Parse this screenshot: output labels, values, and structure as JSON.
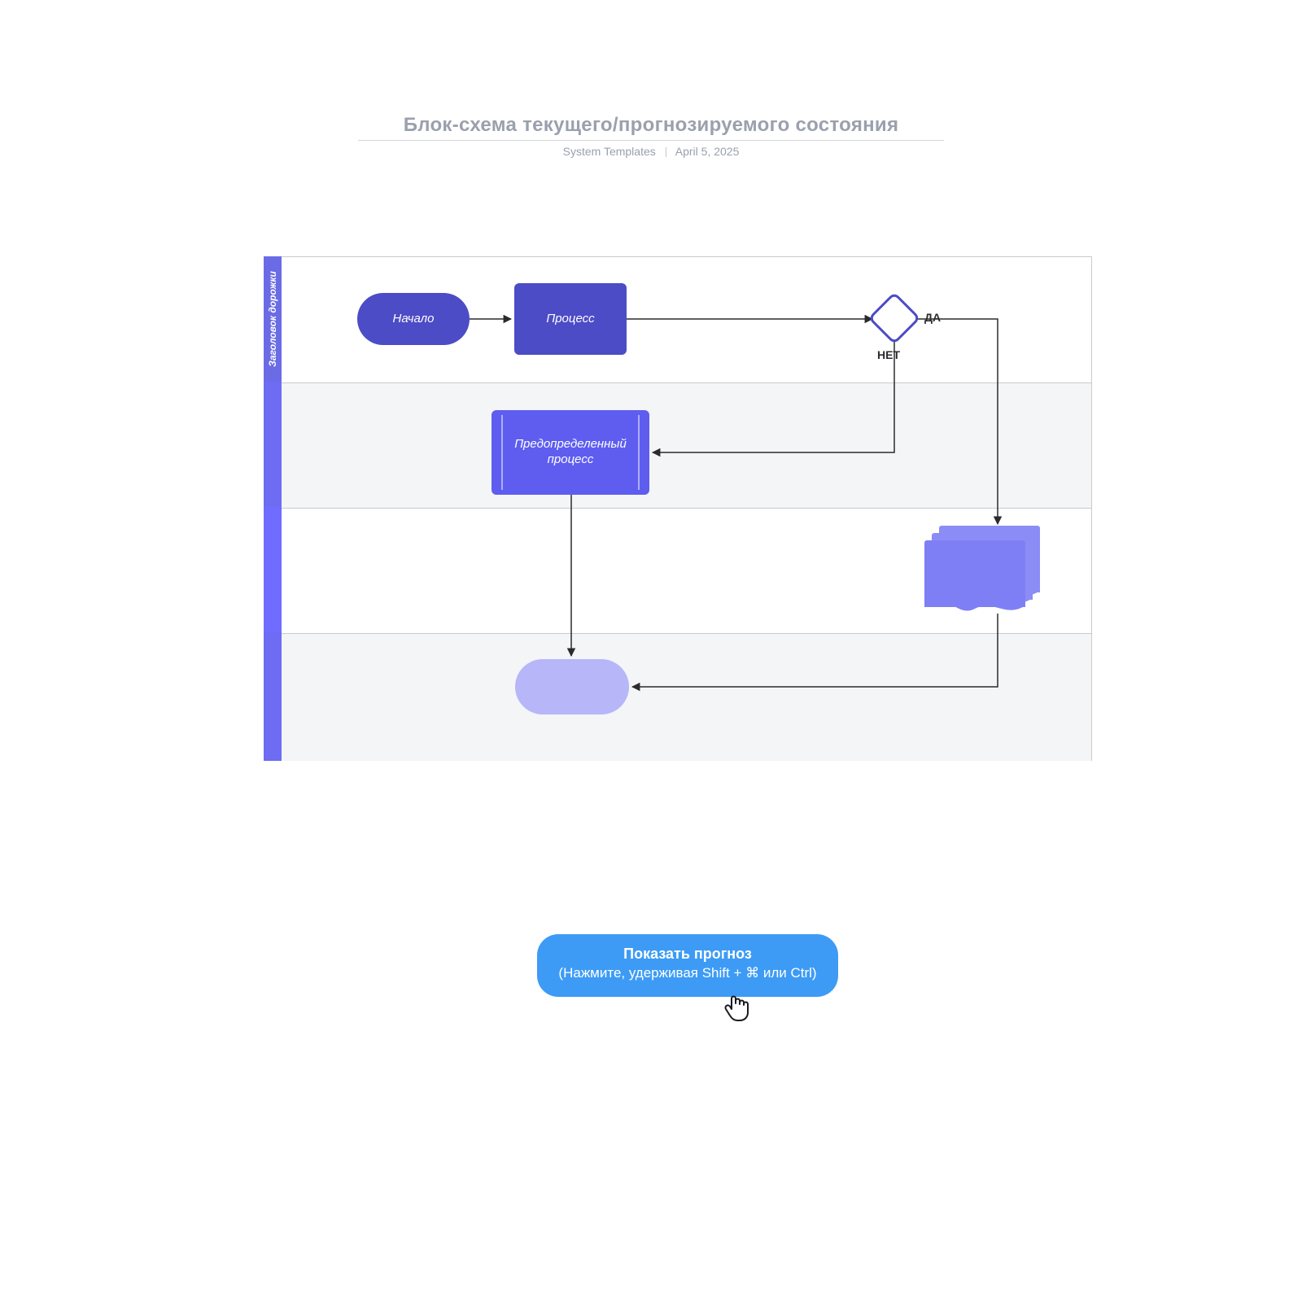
{
  "header": {
    "title": "Блок-схема текущего/прогнозируемого состояния",
    "source": "System Templates",
    "date": "April 5, 2025"
  },
  "swimlane": {
    "lane1_title": "Заголовок дорожки"
  },
  "nodes": {
    "start": "Начало",
    "process": "Процесс",
    "predefined": "Предопределенный процесс"
  },
  "decision": {
    "yes": "ДА",
    "no": "НЕТ"
  },
  "cta": {
    "title": "Показать прогноз",
    "subtitle": "(Нажмите, удерживая Shift + ⌘ или Ctrl)"
  },
  "colors": {
    "primary_dark": "#4c4cc6",
    "primary": "#5e5df0",
    "primary_light": "#8c8cf6",
    "primary_pale": "#b6b6f8",
    "cta_blue": "#3d9bf5"
  }
}
